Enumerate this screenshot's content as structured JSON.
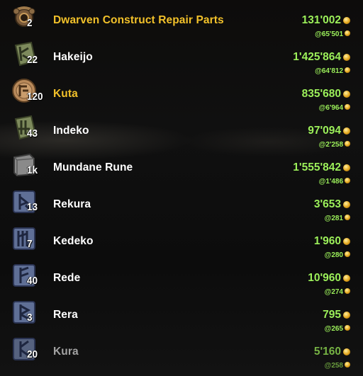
{
  "items": [
    {
      "name": "Dwarven Construct Repair Parts",
      "count": "2",
      "price": "131'002",
      "unit_price": "@65'501",
      "name_color": "gold",
      "icon": "dwarven-parts-icon"
    },
    {
      "name": "Hakeijo",
      "count": "22",
      "price": "1'425'864",
      "unit_price": "@64'812",
      "name_color": "white",
      "icon": "potency-rune-green-icon"
    },
    {
      "name": "Kuta",
      "count": "120",
      "price": "835'680",
      "unit_price": "@6'964",
      "name_color": "gold",
      "icon": "aspect-rune-round-icon"
    },
    {
      "name": "Indeko",
      "count": "43",
      "price": "97'094",
      "unit_price": "@2'258",
      "name_color": "white",
      "icon": "potency-rune-green-icon"
    },
    {
      "name": "Mundane Rune",
      "count": "1k",
      "price": "1'555'842",
      "unit_price": "@1'486",
      "name_color": "white",
      "icon": "mundane-rune-icon"
    },
    {
      "name": "Rekura",
      "count": "13",
      "price": "3'653",
      "unit_price": "@281",
      "name_color": "white",
      "icon": "essence-rune-blue-icon"
    },
    {
      "name": "Kedeko",
      "count": "7",
      "price": "1'960",
      "unit_price": "@280",
      "name_color": "white",
      "icon": "essence-rune-blue-icon"
    },
    {
      "name": "Rede",
      "count": "40",
      "price": "10'960",
      "unit_price": "@274",
      "name_color": "white",
      "icon": "essence-rune-blue-icon"
    },
    {
      "name": "Rera",
      "count": "3",
      "price": "795",
      "unit_price": "@265",
      "name_color": "white",
      "icon": "essence-rune-blue-icon"
    },
    {
      "name": "Kura",
      "count": "20",
      "price": "5'160",
      "unit_price": "@258",
      "name_color": "dim",
      "icon": "essence-rune-blue-icon"
    }
  ],
  "colors": {
    "gold_name": "#f2c12a",
    "price_green": "#9cf05a",
    "white_name": "#ffffff"
  }
}
